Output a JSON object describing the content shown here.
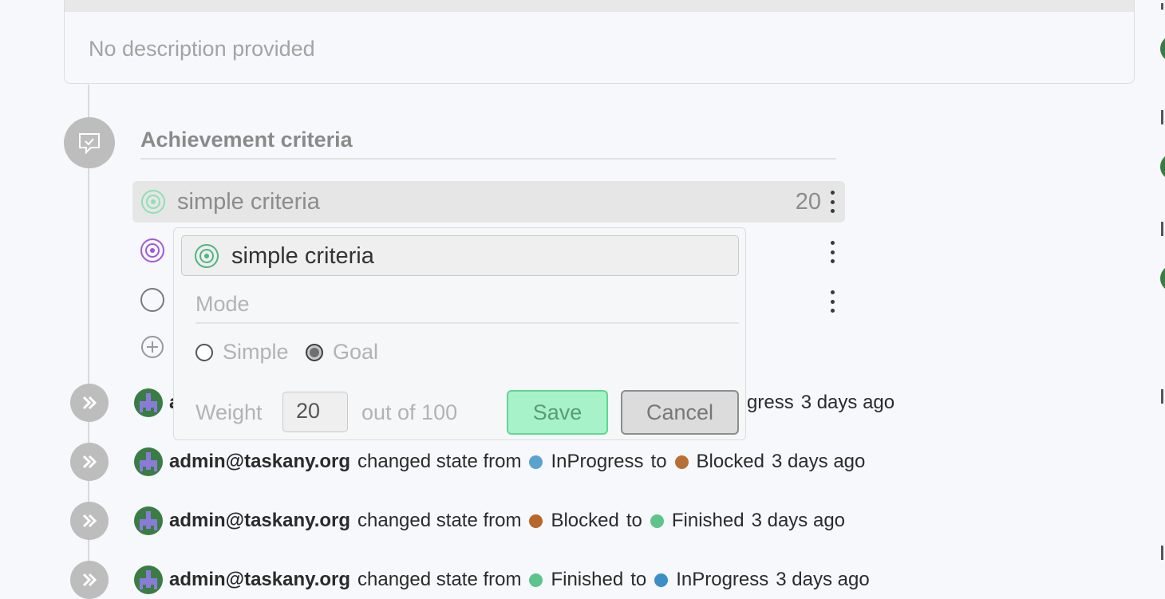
{
  "description": {
    "text": "No description provided"
  },
  "section": {
    "title": "Achievement criteria"
  },
  "criteria": [
    {
      "label": "simple criteria",
      "weight": "20",
      "color": "#7bd9a9"
    },
    {
      "label": "",
      "color": "#a05ad9"
    },
    {
      "label": "",
      "color": "#7a7a7a"
    }
  ],
  "popup": {
    "name_value": "simple criteria",
    "mode_label": "Mode",
    "option_simple": "Simple",
    "option_goal": "Goal",
    "selected_mode": "Goal",
    "weight_label": "Weight",
    "weight_value": "20",
    "outof_label": "out of 100",
    "save_label": "Save",
    "cancel_label": "Cancel"
  },
  "activities": [
    {
      "user": "a",
      "text": "",
      "from": "",
      "from_color": "",
      "to": "gress",
      "to_color": "",
      "time": "3 days ago",
      "partial": true
    },
    {
      "user": "admin@taskany.org",
      "text": "changed state from",
      "from": "InProgress",
      "from_color": "#5ba3cf",
      "to": "Blocked",
      "to_color": "#b86f34",
      "to_word": "to",
      "time": "3 days ago"
    },
    {
      "user": "admin@taskany.org",
      "text": "changed state from",
      "from": "Blocked",
      "from_color": "#b8662a",
      "to": "Finished",
      "to_color": "#5ec48a",
      "to_word": "to",
      "time": "3 days ago"
    },
    {
      "user": "admin@taskany.org",
      "text": "changed state from",
      "from": "Finished",
      "from_color": "#5ec48a",
      "to": "InProgress",
      "to_color": "#3a8fc7",
      "to_word": "to",
      "time": "3 days ago"
    }
  ],
  "colors": {
    "accent_green": "#a8f2c9",
    "avatar_green": "#3a7d44",
    "avatar_figure": "#8a7bd9"
  }
}
